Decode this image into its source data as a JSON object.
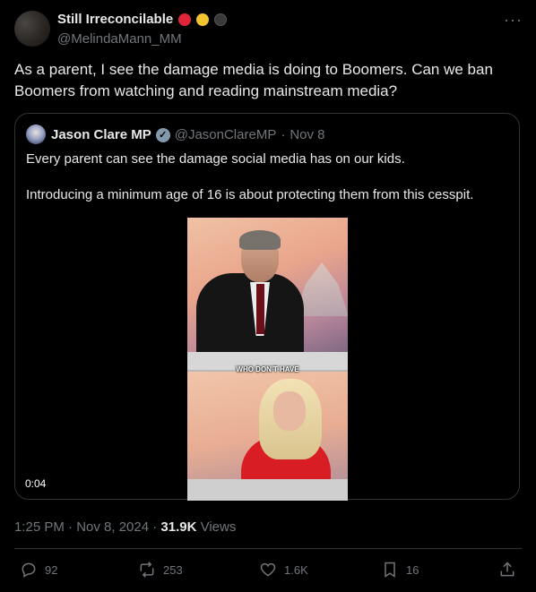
{
  "author": {
    "name": "Still Irreconcilable",
    "handle": "@MelindaMann_MM",
    "emoji_colors": [
      "#e0243a",
      "#f4c430",
      "#3a3a3a"
    ]
  },
  "tweet_text": "As a parent, I see the damage media is doing to Boomers. Can we ban Boomers from watching and reading mainstream media?",
  "quoted": {
    "name": "Jason Clare MP",
    "handle": "@JasonClareMP",
    "date": "Nov 8",
    "text_line1": "Every parent can see the damage social media has on our kids.",
    "text_line2": "Introducing a minimum age of 16 is about protecting them from this cesspit.",
    "video_caption": "WHO DON'T HAVE",
    "video_time": "0:04"
  },
  "meta": {
    "time_date": "1:25 PM · Nov 8, 2024 · ",
    "views_count": "31.9K",
    "views_label": " Views"
  },
  "actions": {
    "replies": "92",
    "reposts": "253",
    "likes": "1.6K",
    "bookmarks": "16"
  }
}
